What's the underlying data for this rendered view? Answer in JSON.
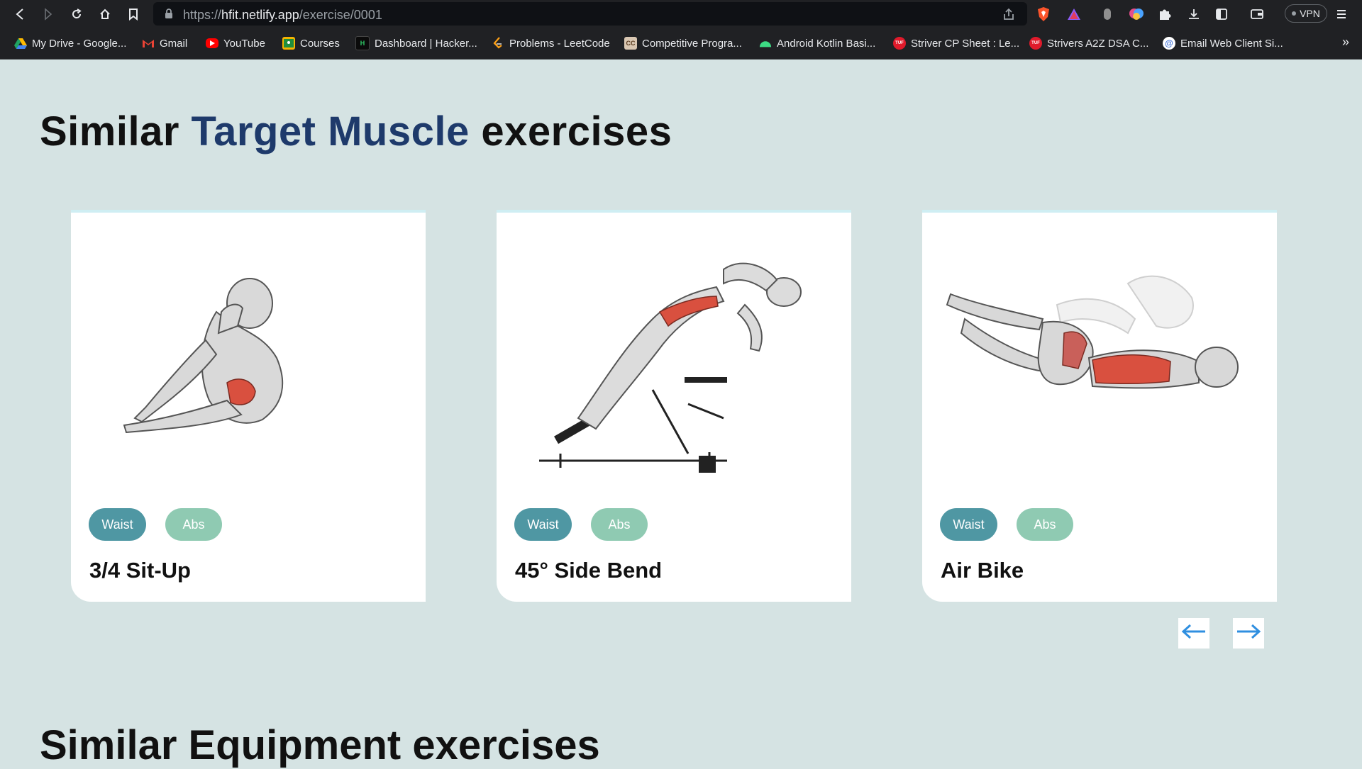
{
  "browser": {
    "url_scheme": "https://",
    "url_host": "hfit.netlify.app",
    "url_path": "/exercise/0001",
    "vpn_label": "VPN",
    "bookmarks": [
      {
        "label": "My Drive - Google...",
        "icon": "google-drive-icon",
        "color": "#1fa463"
      },
      {
        "label": "Gmail",
        "icon": "gmail-icon",
        "color": "#ea4335"
      },
      {
        "label": "YouTube",
        "icon": "youtube-icon",
        "color": "#ff0000"
      },
      {
        "label": "Courses",
        "icon": "classroom-icon",
        "color": "#f4b400"
      },
      {
        "label": "Dashboard | Hacker...",
        "icon": "hackerrank-icon",
        "color": "#0b0b0b"
      },
      {
        "label": "Problems - LeetCode",
        "icon": "leetcode-icon",
        "color": "#ffa116"
      },
      {
        "label": "Competitive Progra...",
        "icon": "codechef-icon",
        "color": "#8a6a4a"
      },
      {
        "label": "Android Kotlin Basi...",
        "icon": "android-icon",
        "color": "#3ddc84"
      },
      {
        "label": "Striver CP Sheet : Le...",
        "icon": "tuf-icon",
        "color": "#e01a2b"
      },
      {
        "label": "Strivers A2Z DSA C...",
        "icon": "tuf-icon",
        "color": "#e01a2b"
      },
      {
        "label": "Email Web Client Si...",
        "icon": "email-client-icon",
        "color": "#3b6fd8"
      }
    ]
  },
  "page": {
    "heading_pre": "Similar ",
    "heading_accent": "Target Muscle",
    "heading_post": " exercises",
    "next_heading": "Similar Equipment exercises",
    "cards": [
      {
        "name": "3/4 Sit-Up",
        "tag1": "Waist",
        "tag2": "Abs"
      },
      {
        "name": "45° Side Bend",
        "tag1": "Waist",
        "tag2": "Abs"
      },
      {
        "name": "Air Bike",
        "tag1": "Waist",
        "tag2": "Abs"
      }
    ]
  },
  "colors": {
    "page_bg": "#d5e3e3",
    "accent_heading": "#1e3a6b",
    "chip_waist": "#4f97a3",
    "chip_abs": "#8fcab2",
    "muscle_highlight": "#d9503f"
  }
}
